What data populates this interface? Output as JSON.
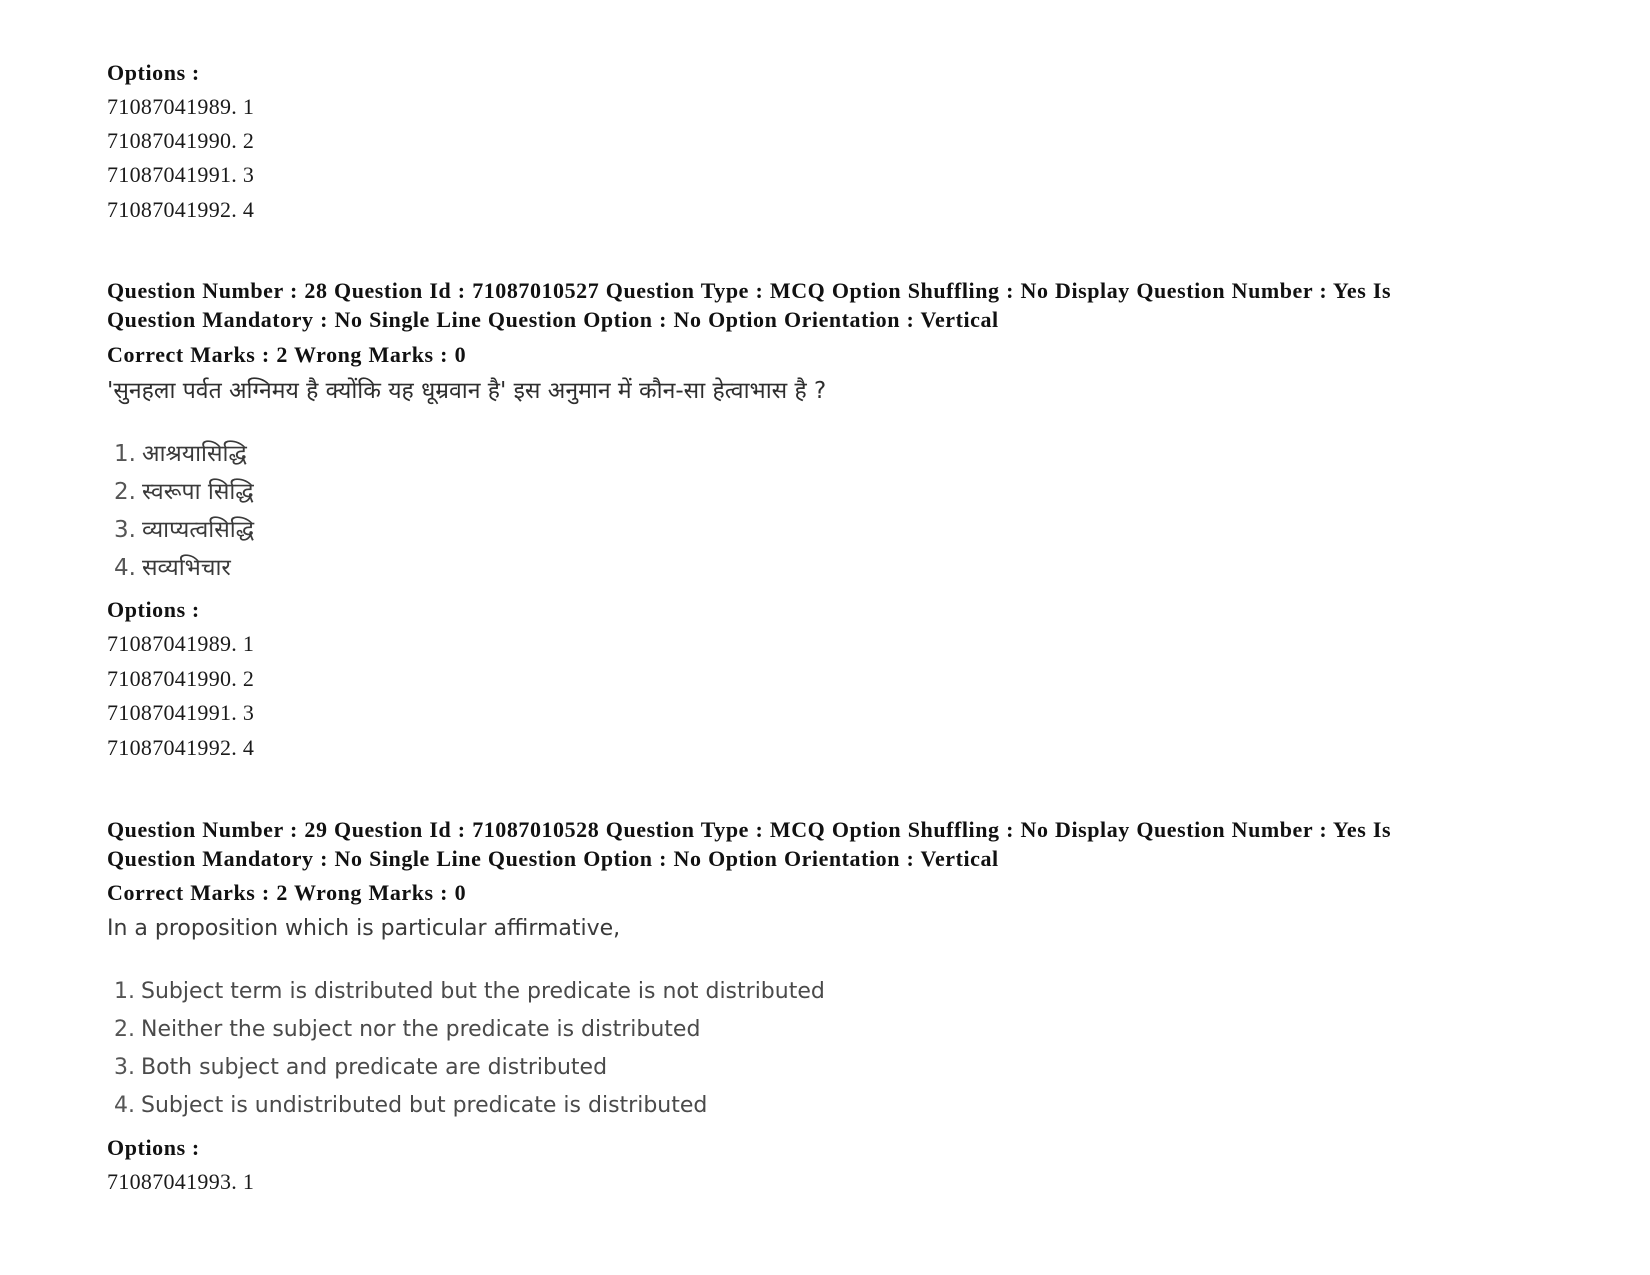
{
  "top_block": {
    "options_label": "Options :",
    "options": [
      "71087041989. 1",
      "71087041990. 2",
      "71087041991. 3",
      "71087041992. 4"
    ]
  },
  "questions": [
    {
      "meta_line_1": "Question Number : 28 Question Id : 71087010527 Question Type : MCQ Option Shuffling : No Display Question Number : Yes Is",
      "meta_line_2": "Question Mandatory : No Single Line Question Option : No Option Orientation : Vertical",
      "marks_line": "Correct Marks : 2 Wrong Marks : 0",
      "question_text": "'सुनहला पर्वत अग्निमय है क्योंकि यह धूम्रवान है' इस अनुमान में कौन-सा हेत्वाभास है ?",
      "choices": [
        {
          "num": "1.",
          "text": "आश्रयासिद्धि"
        },
        {
          "num": "2.",
          "text": "स्वरूपा सिद्धि"
        },
        {
          "num": "3.",
          "text": "व्याप्यत्वसिद्धि"
        },
        {
          "num": "4.",
          "text": "सव्यभिचार"
        }
      ],
      "options_label": "Options :",
      "options": [
        "71087041989. 1",
        "71087041990. 2",
        "71087041991. 3",
        "71087041992. 4"
      ]
    },
    {
      "meta_line_1": "Question Number : 29 Question Id : 71087010528 Question Type : MCQ Option Shuffling : No Display Question Number : Yes Is",
      "meta_line_2": "Question Mandatory : No Single Line Question Option : No Option Orientation : Vertical",
      "marks_line": "Correct Marks : 2 Wrong Marks : 0",
      "question_text": "In a proposition which is particular affirmative,",
      "choices": [
        {
          "num": "1.",
          "text": "Subject term is distributed but the predicate is not distributed"
        },
        {
          "num": "2.",
          "text": "Neither the subject nor the predicate is distributed"
        },
        {
          "num": "3.",
          "text": "Both subject and predicate are distributed"
        },
        {
          "num": "4.",
          "text": "Subject is undistributed but predicate is distributed"
        }
      ],
      "options_label": "Options :",
      "options": [
        "71087041993. 1"
      ]
    }
  ]
}
